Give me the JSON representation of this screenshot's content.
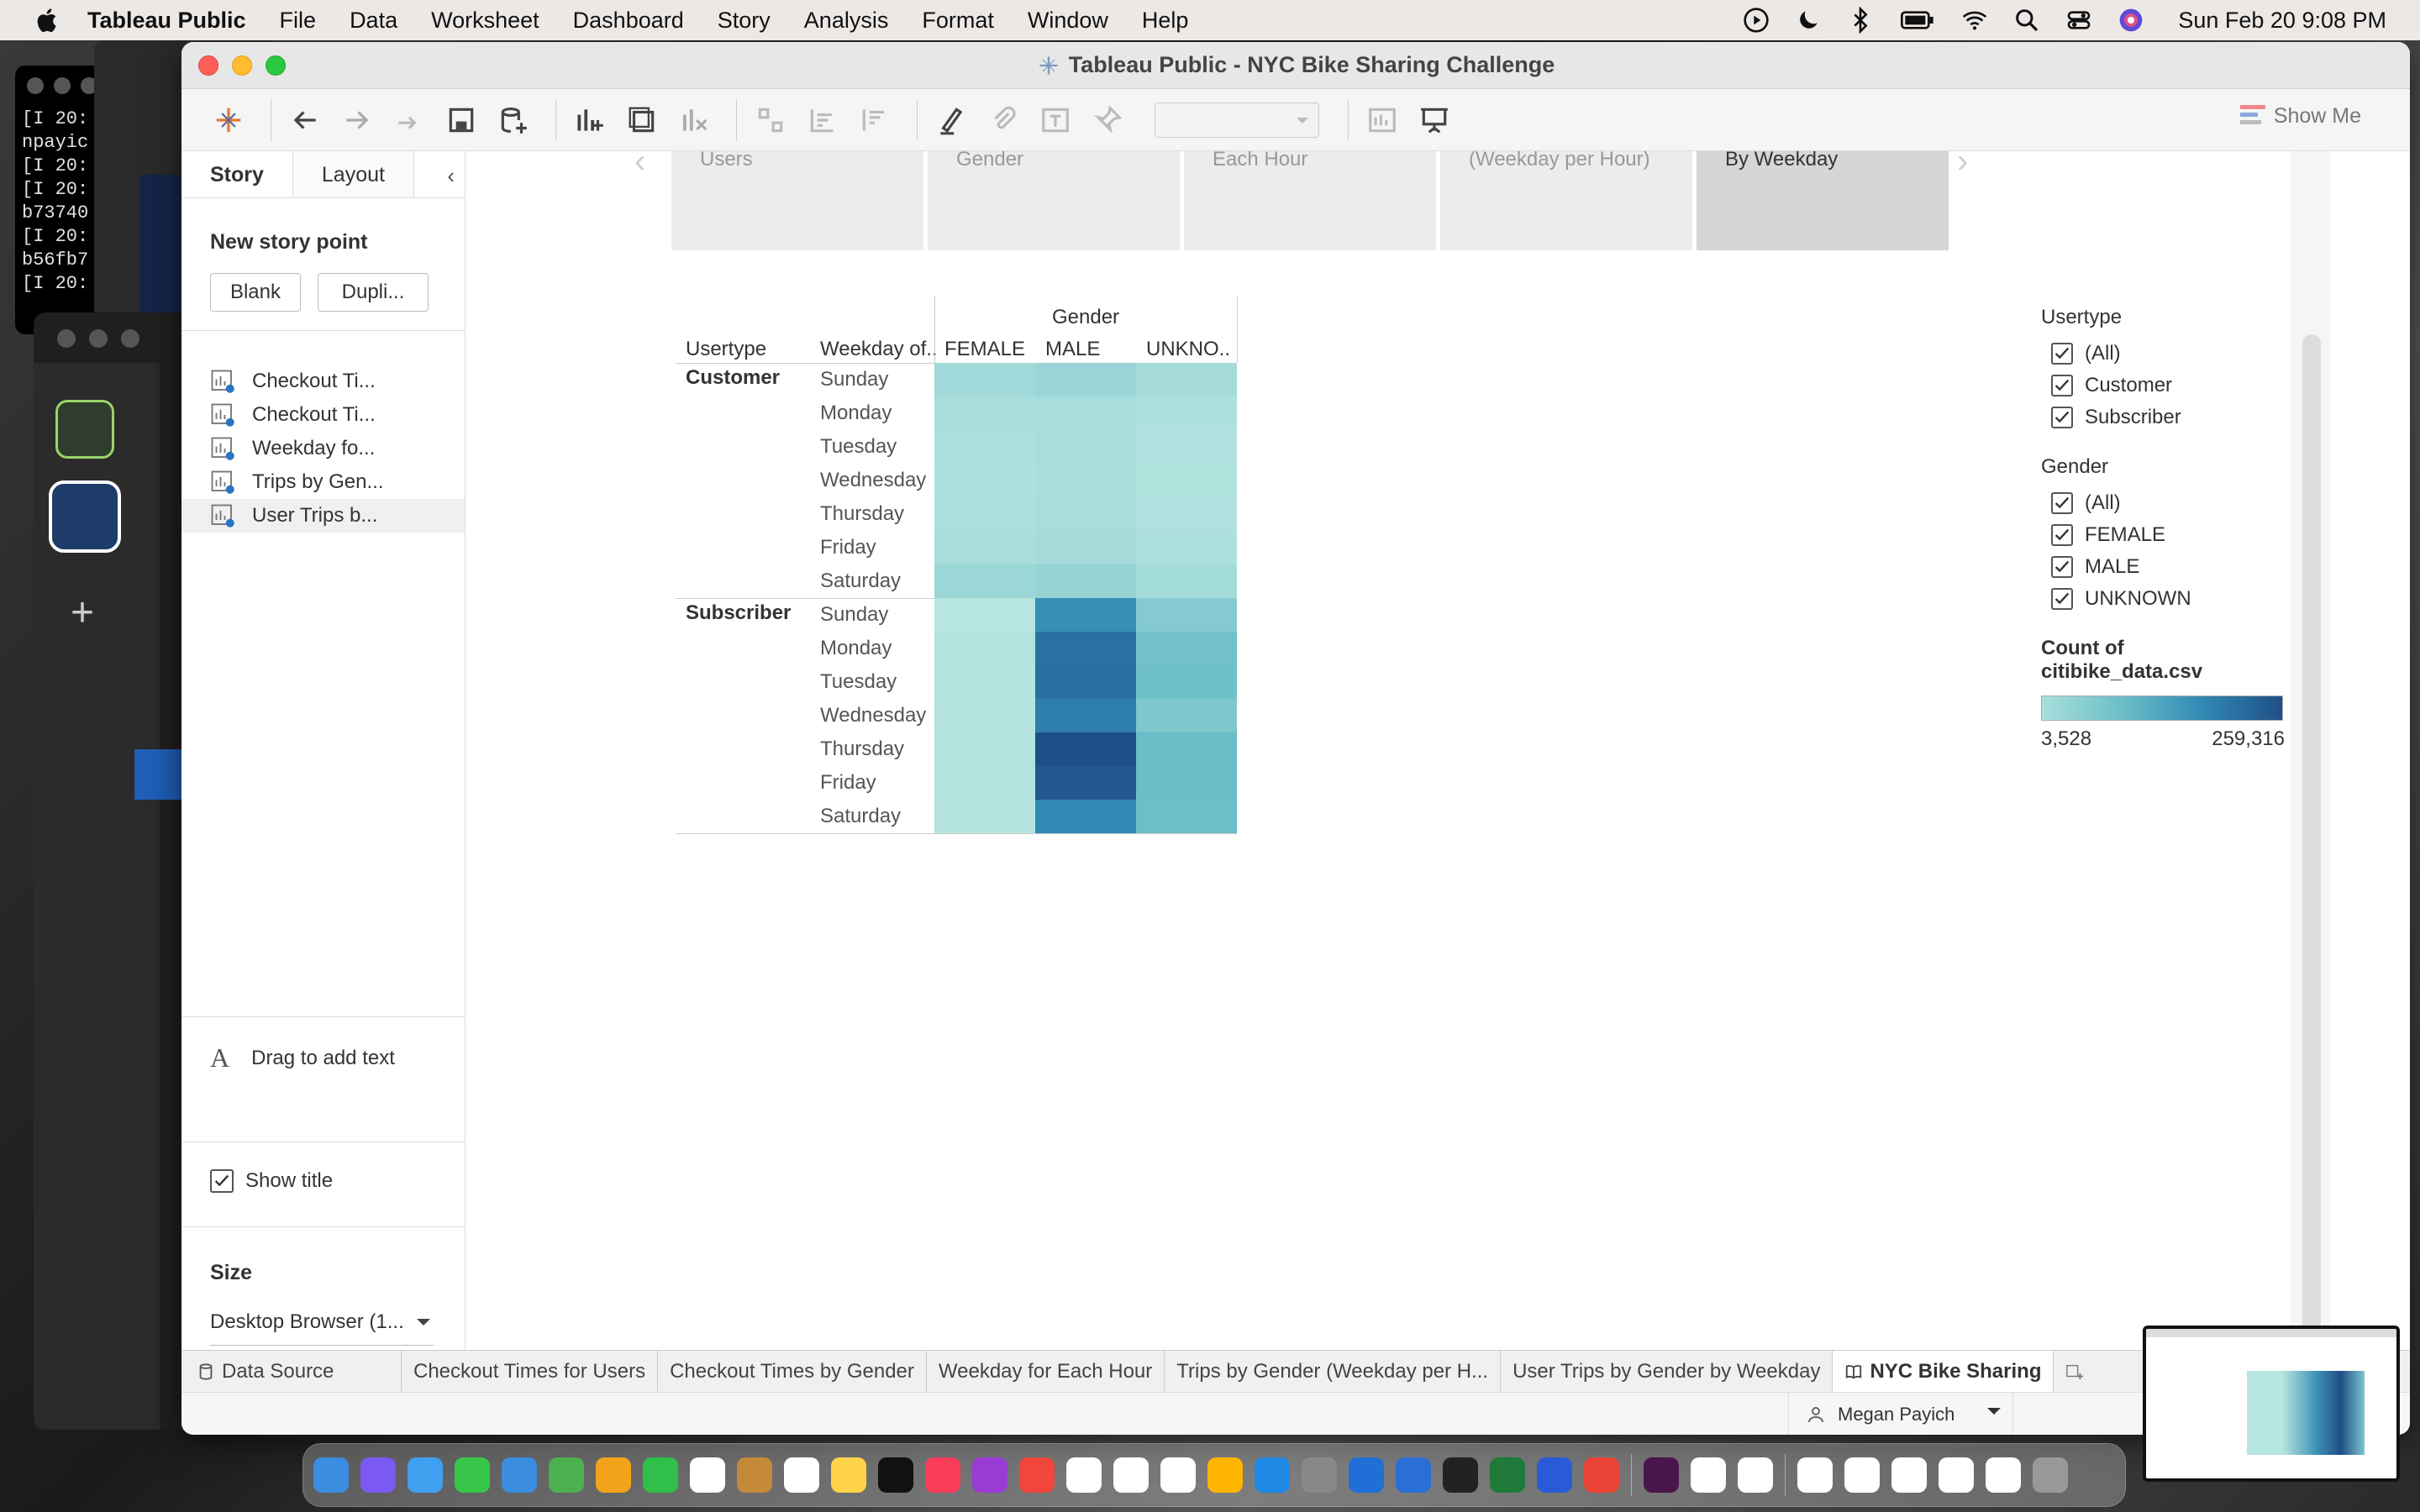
{
  "menubar": {
    "app_name": "Tableau Public",
    "items": [
      "File",
      "Data",
      "Worksheet",
      "Dashboard",
      "Story",
      "Analysis",
      "Format",
      "Window",
      "Help"
    ],
    "clock": "Sun Feb 20  9:08 PM"
  },
  "background_terminal": {
    "lines": [
      "[I 20:",
      "npayic",
      "[I 20:",
      "[I 20:",
      "b73740",
      "[I 20:",
      "b56fb7",
      "[I 20:"
    ]
  },
  "window": {
    "title": "Tableau Public - NYC Bike Sharing Challenge",
    "show_me": "Show Me"
  },
  "story_pane": {
    "tabs": [
      "Story",
      "Layout"
    ],
    "new_story_point_title": "New story point",
    "blank_label": "Blank",
    "duplicate_label": "Dupli...",
    "sheets": [
      "Checkout Ti...",
      "Checkout Ti...",
      "Weekday fo...",
      "Trips by Gen...",
      "User Trips b..."
    ],
    "drag_text_label": "Drag to add text",
    "show_title_label": "Show title",
    "size_title": "Size",
    "size_value": "Desktop Browser (1..."
  },
  "story_points": [
    "Users",
    "Gender",
    "Each Hour",
    "(Weekday per Hour)",
    "By Weekday"
  ],
  "chart_data": {
    "type": "heatmap",
    "title": "",
    "column_group_label": "Gender",
    "row_headers": [
      "Usertype",
      "Weekday of.."
    ],
    "columns": [
      "FEMALE",
      "MALE",
      "UNKNO.."
    ],
    "groups": [
      {
        "name": "Customer",
        "rows": [
          {
            "day": "Sunday",
            "values": [
              30000,
              38000,
              24000
            ]
          },
          {
            "day": "Monday",
            "values": [
              18000,
              22000,
              14000
            ]
          },
          {
            "day": "Tuesday",
            "values": [
              16000,
              20000,
              12000
            ]
          },
          {
            "day": "Wednesday",
            "values": [
              14000,
              18000,
              11000
            ]
          },
          {
            "day": "Thursday",
            "values": [
              16000,
              20000,
              12000
            ]
          },
          {
            "day": "Friday",
            "values": [
              20000,
              24000,
              15000
            ]
          },
          {
            "day": "Saturday",
            "values": [
              34000,
              42000,
              26000
            ]
          }
        ]
      },
      {
        "name": "Subscriber",
        "rows": [
          {
            "day": "Sunday",
            "values": [
              3528,
              165000,
              62000
            ]
          },
          {
            "day": "Monday",
            "values": [
              8000,
              210000,
              82000
            ]
          },
          {
            "day": "Tuesday",
            "values": [
              8000,
              212000,
              84000
            ]
          },
          {
            "day": "Wednesday",
            "values": [
              7000,
              190000,
              70000
            ]
          },
          {
            "day": "Thursday",
            "values": [
              8000,
              259316,
              92000
            ]
          },
          {
            "day": "Friday",
            "values": [
              8000,
              245000,
              90000
            ]
          },
          {
            "day": "Saturday",
            "values": [
              6000,
              175000,
              88000
            ]
          }
        ]
      }
    ],
    "color_range": [
      3528,
      259316
    ],
    "color_min_hex": "#b7e5e0",
    "color_max_hex": "#1f4f86"
  },
  "legends": {
    "usertype": {
      "title": "Usertype",
      "items": [
        "(All)",
        "Customer",
        "Subscriber"
      ]
    },
    "gender": {
      "title": "Gender",
      "items": [
        "(All)",
        "FEMALE",
        "MALE",
        "UNKNOWN"
      ]
    },
    "color": {
      "title": "Count of citibike_data.csv",
      "min_label": "3,528",
      "max_label": "259,316"
    }
  },
  "bottom_tabs": {
    "data_source": "Data Source",
    "sheets": [
      "Checkout Times for Users",
      "Checkout Times by Gender",
      "Weekday for Each Hour",
      "Trips by Gender (Weekday per H...",
      "User Trips by Gender by Weekday"
    ],
    "active_story": "NYC Bike Sharing"
  },
  "status": {
    "user_name": "Megan Payich"
  }
}
